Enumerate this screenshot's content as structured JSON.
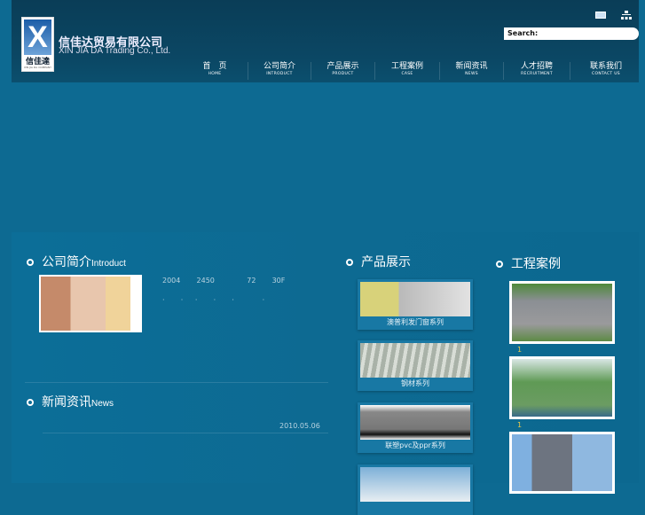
{
  "header": {
    "logo_cn": "信佳達",
    "logo_en": "XIN JIA DA COMPANY",
    "company_cn": "信佳达贸易有限公司",
    "company_en": "XIN JIA DA Trading Co., Ltd.",
    "search_label": "Search:"
  },
  "nav": [
    {
      "cn": "首　页",
      "en": "HOME"
    },
    {
      "cn": "公司简介",
      "en": "INTRODUCT"
    },
    {
      "cn": "产品展示",
      "en": "PRODUCT"
    },
    {
      "cn": "工程案例",
      "en": "CASE"
    },
    {
      "cn": "新闻资讯",
      "en": "NEWS"
    },
    {
      "cn": "人才招聘",
      "en": "RECRUITMENT"
    },
    {
      "cn": "联系我们",
      "en": "CONTACT US"
    }
  ],
  "intro": {
    "title_cn": "公司简介",
    "title_en": "Introduct",
    "text": "2004    2450        72    30F",
    "dots": "·    ·   ·    ·    ·       ·"
  },
  "news": {
    "title_cn": "新闻资讯",
    "title_en": "News",
    "date": "2010.05.06"
  },
  "products": {
    "title": "产品展示",
    "items": [
      "澳普利发门窗系列",
      "钢材系列",
      "联塑pvc及ppr系列"
    ]
  },
  "cases": {
    "title": "工程案例",
    "items": [
      "1",
      "1"
    ]
  }
}
